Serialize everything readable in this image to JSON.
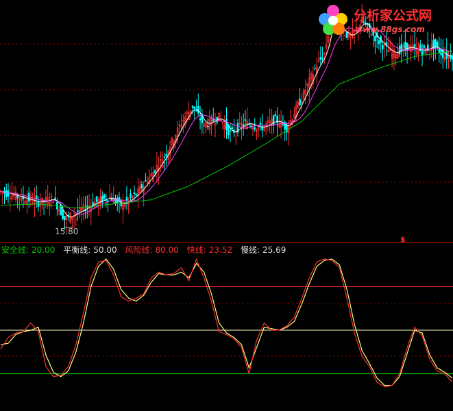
{
  "logo": {
    "text": "分析家公式网",
    "url": "www.88gs.com"
  },
  "annotations": {
    "low_price": "15.80",
    "marker": "$"
  },
  "legend": [
    {
      "label": "安全线:",
      "value": "20.00",
      "color": "#00cc00"
    },
    {
      "label": "平衡线:",
      "value": "50.00",
      "color": "#e0e0e0"
    },
    {
      "label": "风险线:",
      "value": "80.00",
      "color": "#ff3030"
    },
    {
      "label": "快线:",
      "value": "23.52",
      "color": "#ff3030"
    },
    {
      "label": "慢线:",
      "value": "25.69",
      "color": "#e0e0e0"
    }
  ],
  "colors": {
    "up": "#ff3030",
    "down": "#00ffff",
    "ma_short": "#ffffff",
    "ma_mid": "#ff40ff",
    "ma_long": "#00cc00",
    "fast": "#ff3030",
    "slow": "#ffff80",
    "safe": "#00cc00",
    "balance": "#ffffc0",
    "risk": "#ff3030",
    "grid": "#a00000"
  },
  "chart_data": [
    {
      "type": "candlestick",
      "price_anchors": [
        [
          0,
          18.4
        ],
        [
          10,
          18.0
        ],
        [
          20,
          17.6
        ],
        [
          28,
          17.9
        ],
        [
          34,
          16.4
        ],
        [
          42,
          17.0
        ],
        [
          50,
          17.6
        ],
        [
          58,
          18.0
        ],
        [
          64,
          17.4
        ],
        [
          72,
          18.2
        ],
        [
          80,
          19.6
        ],
        [
          88,
          21.2
        ],
        [
          96,
          23.4
        ],
        [
          102,
          24.6
        ],
        [
          108,
          23.2
        ],
        [
          116,
          23.8
        ],
        [
          122,
          22.6
        ],
        [
          130,
          23.4
        ],
        [
          138,
          23.0
        ],
        [
          146,
          23.6
        ],
        [
          152,
          23.0
        ],
        [
          160,
          25.2
        ],
        [
          168,
          27.6
        ],
        [
          172,
          28.4
        ],
        [
          176,
          31.2
        ],
        [
          180,
          30.2
        ],
        [
          186,
          29.6
        ],
        [
          192,
          30.8
        ],
        [
          200,
          29.4
        ],
        [
          208,
          28.4
        ],
        [
          216,
          28.9
        ],
        [
          224,
          28.6
        ],
        [
          230,
          29.0
        ],
        [
          236,
          28.2
        ],
        [
          240,
          28.3
        ]
      ],
      "ma_long_anchors": [
        [
          0,
          17.4
        ],
        [
          20,
          17.5
        ],
        [
          40,
          17.2
        ],
        [
          60,
          17.5
        ],
        [
          80,
          17.8
        ],
        [
          100,
          18.8
        ],
        [
          120,
          20.2
        ],
        [
          140,
          21.8
        ],
        [
          160,
          23.5
        ],
        [
          180,
          26.2
        ],
        [
          200,
          27.3
        ],
        [
          220,
          28.2
        ],
        [
          240,
          28.6
        ]
      ],
      "annotation_low": 15.8
    },
    {
      "type": "line",
      "series": [
        {
          "name": "快线",
          "anchors": [
            [
              0,
              37
            ],
            [
              4,
              45
            ],
            [
              8,
              48
            ],
            [
              12,
              49
            ],
            [
              16,
              55
            ],
            [
              20,
              49
            ],
            [
              24,
              25
            ],
            [
              28,
              18
            ],
            [
              32,
              19
            ],
            [
              36,
              25
            ],
            [
              40,
              40
            ],
            [
              44,
              62
            ],
            [
              48,
              86
            ],
            [
              52,
              97
            ],
            [
              56,
              98
            ],
            [
              60,
              88
            ],
            [
              64,
              73
            ],
            [
              68,
              70
            ],
            [
              72,
              72
            ],
            [
              76,
              75
            ],
            [
              80,
              86
            ],
            [
              84,
              90
            ],
            [
              88,
              88
            ],
            [
              92,
              89
            ],
            [
              96,
              93
            ],
            [
              100,
              84
            ],
            [
              104,
              99
            ],
            [
              108,
              86
            ],
            [
              112,
              70
            ],
            [
              116,
              49
            ],
            [
              120,
              47
            ],
            [
              124,
              44
            ],
            [
              128,
              38
            ],
            [
              132,
              20
            ],
            [
              136,
              43
            ],
            [
              140,
              55
            ],
            [
              144,
              50
            ],
            [
              148,
              50
            ],
            [
              152,
              53
            ],
            [
              156,
              59
            ],
            [
              160,
              72
            ],
            [
              164,
              86
            ],
            [
              168,
              97
            ],
            [
              172,
              99
            ],
            [
              176,
              98
            ],
            [
              180,
              93
            ],
            [
              184,
              72
            ],
            [
              188,
              48
            ],
            [
              192,
              32
            ],
            [
              196,
              25
            ],
            [
              200,
              14
            ],
            [
              204,
              11
            ],
            [
              208,
              12
            ],
            [
              212,
              20
            ],
            [
              216,
              38
            ],
            [
              220,
              52
            ],
            [
              224,
              46
            ],
            [
              228,
              30
            ],
            [
              232,
              22
            ],
            [
              236,
              20
            ],
            [
              240,
              14
            ]
          ]
        },
        {
          "name": "慢线",
          "anchors": [
            [
              0,
              40
            ],
            [
              4,
              41
            ],
            [
              8,
              47
            ],
            [
              12,
              49
            ],
            [
              16,
              50
            ],
            [
              20,
              52
            ],
            [
              24,
              33
            ],
            [
              28,
              21
            ],
            [
              32,
              18
            ],
            [
              36,
              22
            ],
            [
              40,
              35
            ],
            [
              44,
              55
            ],
            [
              48,
              80
            ],
            [
              52,
              94
            ],
            [
              56,
              99
            ],
            [
              60,
              92
            ],
            [
              64,
              78
            ],
            [
              68,
              72
            ],
            [
              72,
              70
            ],
            [
              76,
              74
            ],
            [
              80,
              83
            ],
            [
              84,
              89
            ],
            [
              88,
              88
            ],
            [
              92,
              88
            ],
            [
              96,
              90
            ],
            [
              100,
              86
            ],
            [
              104,
              96
            ],
            [
              108,
              90
            ],
            [
              112,
              75
            ],
            [
              116,
              55
            ],
            [
              120,
              48
            ],
            [
              124,
              45
            ],
            [
              128,
              40
            ],
            [
              132,
              24
            ],
            [
              136,
              38
            ],
            [
              140,
              52
            ],
            [
              144,
              51
            ],
            [
              148,
              50
            ],
            [
              152,
              52
            ],
            [
              156,
              56
            ],
            [
              160,
              68
            ],
            [
              164,
              82
            ],
            [
              168,
              94
            ],
            [
              172,
              98
            ],
            [
              176,
              99
            ],
            [
              180,
              95
            ],
            [
              184,
              78
            ],
            [
              188,
              54
            ],
            [
              192,
              36
            ],
            [
              196,
              27
            ],
            [
              200,
              17
            ],
            [
              204,
              12
            ],
            [
              208,
              12
            ],
            [
              212,
              18
            ],
            [
              216,
              34
            ],
            [
              220,
              50
            ],
            [
              224,
              48
            ],
            [
              228,
              33
            ],
            [
              232,
              24
            ],
            [
              236,
              21
            ],
            [
              240,
              17
            ]
          ]
        }
      ],
      "levels": [
        20,
        50,
        80
      ],
      "ylim": [
        0,
        100
      ]
    }
  ]
}
